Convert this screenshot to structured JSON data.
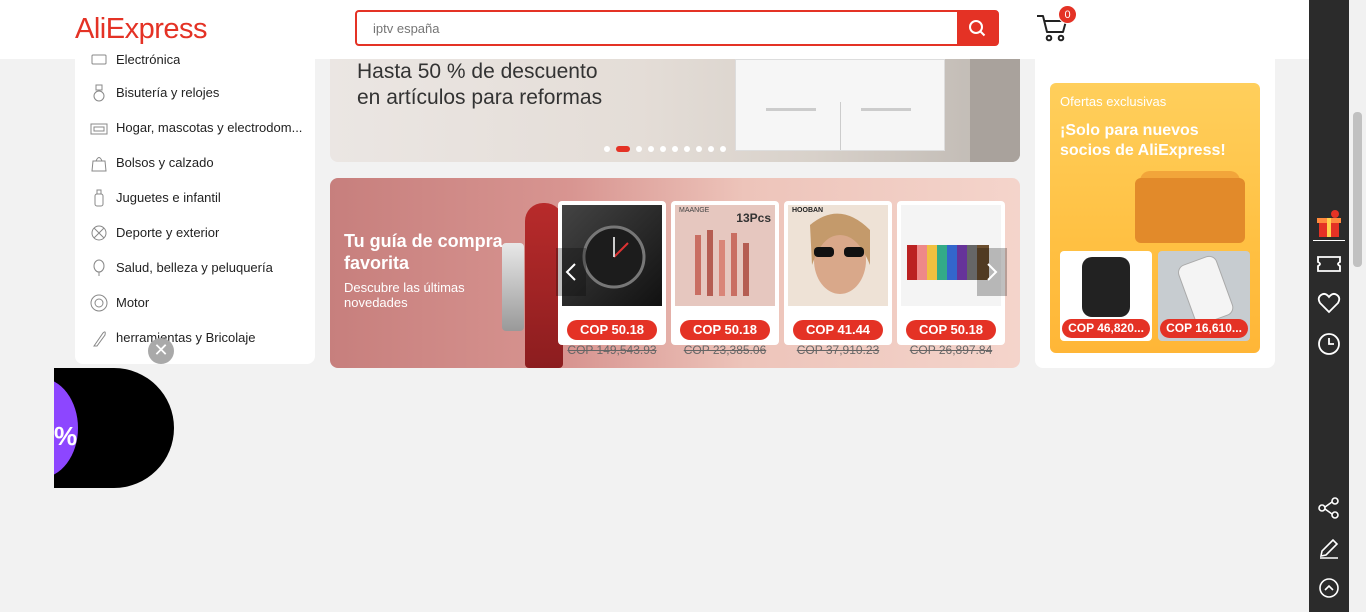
{
  "header": {
    "logo": "AliExpress",
    "search_placeholder": "iptv españa",
    "cart_count": "0"
  },
  "categories": [
    {
      "label": "Electrónica",
      "icon": "electronics-icon"
    },
    {
      "label": "Bisutería y relojes",
      "icon": "ring-icon"
    },
    {
      "label": "Hogar, mascotas y electrodom...",
      "icon": "sofa-icon"
    },
    {
      "label": "Bolsos y calzado",
      "icon": "bag-icon"
    },
    {
      "label": "Juguetes e infantil",
      "icon": "baby-bottle-icon"
    },
    {
      "label": "Deporte y exterior",
      "icon": "ball-icon"
    },
    {
      "label": "Salud, belleza y peluquería",
      "icon": "lipstick-icon"
    },
    {
      "label": "Motor",
      "icon": "wheel-icon"
    },
    {
      "label": "herramientas y Bricolaje",
      "icon": "tools-icon"
    }
  ],
  "banner_top": {
    "line1": "Hasta 50 % de descuento",
    "line2": "en artículos para reformas",
    "dots": 10,
    "active_dot": 1
  },
  "banner_bottom": {
    "heading": "Tu guía de compra favorita",
    "sub": "Descubre las últimas novedades",
    "products": [
      {
        "price": "COP 50.18",
        "old_price": "COP 149,543.93",
        "img": "watch"
      },
      {
        "price": "COP 50.18",
        "old_price": "COP 23,385.06",
        "img": "brushes",
        "img_label": "13Pcs",
        "brand": "MAANGE"
      },
      {
        "price": "COP 41.44",
        "old_price": "COP 37,910.23",
        "img": "sunglasses",
        "brand": "HOOBAN"
      },
      {
        "price": "COP 50.18",
        "old_price": "COP 26,897.84",
        "img": "pencil-case"
      }
    ]
  },
  "promo": {
    "tag": "Ofertas exclusivas",
    "title": "¡Solo para nuevos socios de AliExpress!",
    "items": [
      {
        "price": "COP 46,820..."
      },
      {
        "price": "COP 16,610..."
      }
    ]
  },
  "floating": {
    "bubble_text": "%",
    "close_label": "✕"
  },
  "colors": {
    "accent": "#e43225",
    "promo_bg": "#ffc042",
    "toolbar": "#2b2b2b"
  }
}
